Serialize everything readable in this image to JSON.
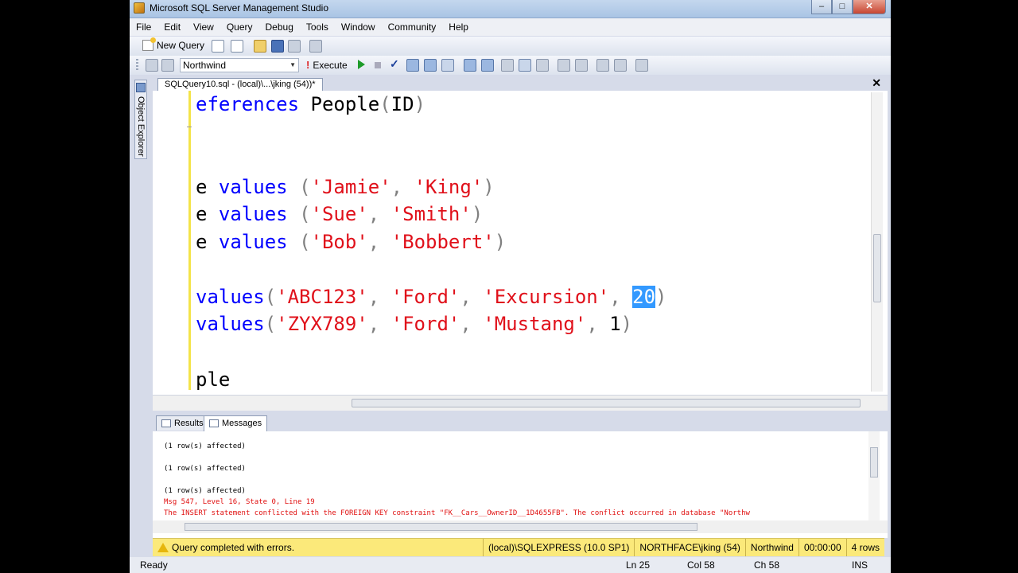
{
  "window": {
    "title": "Microsoft SQL Server Management Studio",
    "min": "–",
    "max": "□",
    "close": "✕"
  },
  "menu": [
    "File",
    "Edit",
    "View",
    "Query",
    "Debug",
    "Tools",
    "Window",
    "Community",
    "Help"
  ],
  "toolbar": {
    "new_query": "New Query",
    "database": "Northwind",
    "execute": "Execute",
    "execute_mark": "!"
  },
  "object_explorer": {
    "label": "Object Explorer"
  },
  "document": {
    "tab_title": "SQLQuery10.sql - (local)\\...\\jking (54))*",
    "close": "✕"
  },
  "code_lines": [
    {
      "segments": [
        {
          "t": "eferences ",
          "c": "kw"
        },
        {
          "t": "People",
          "c": "plain"
        },
        {
          "t": "(",
          "c": "op"
        },
        {
          "t": "ID",
          "c": "plain"
        },
        {
          "t": ")",
          "c": "op"
        }
      ]
    },
    {
      "segments": [
        {
          "t": "e ",
          "c": "plain"
        },
        {
          "t": "values ",
          "c": "kw"
        },
        {
          "t": "(",
          "c": "op"
        },
        {
          "t": "'Jamie'",
          "c": "str"
        },
        {
          "t": ", ",
          "c": "op"
        },
        {
          "t": "'King'",
          "c": "str"
        },
        {
          "t": ")",
          "c": "op"
        }
      ]
    },
    {
      "segments": [
        {
          "t": "e ",
          "c": "plain"
        },
        {
          "t": "values ",
          "c": "kw"
        },
        {
          "t": "(",
          "c": "op"
        },
        {
          "t": "'Sue'",
          "c": "str"
        },
        {
          "t": ", ",
          "c": "op"
        },
        {
          "t": "'Smith'",
          "c": "str"
        },
        {
          "t": ")",
          "c": "op"
        }
      ]
    },
    {
      "segments": [
        {
          "t": "e ",
          "c": "plain"
        },
        {
          "t": "values ",
          "c": "kw"
        },
        {
          "t": "(",
          "c": "op"
        },
        {
          "t": "'Bob'",
          "c": "str"
        },
        {
          "t": ", ",
          "c": "op"
        },
        {
          "t": "'Bobbert'",
          "c": "str"
        },
        {
          "t": ")",
          "c": "op"
        }
      ]
    },
    {
      "segments": [
        {
          "t": "values",
          "c": "kw"
        },
        {
          "t": "(",
          "c": "op"
        },
        {
          "t": "'ABC123'",
          "c": "str"
        },
        {
          "t": ", ",
          "c": "op"
        },
        {
          "t": "'Ford'",
          "c": "str"
        },
        {
          "t": ", ",
          "c": "op"
        },
        {
          "t": "'Excursion'",
          "c": "str"
        },
        {
          "t": ", ",
          "c": "op"
        },
        {
          "t": "20",
          "c": "hl"
        },
        {
          "t": ")",
          "c": "op"
        }
      ]
    },
    {
      "segments": [
        {
          "t": "values",
          "c": "kw"
        },
        {
          "t": "(",
          "c": "op"
        },
        {
          "t": "'ZYX789'",
          "c": "str"
        },
        {
          "t": ", ",
          "c": "op"
        },
        {
          "t": "'Ford'",
          "c": "str"
        },
        {
          "t": ", ",
          "c": "op"
        },
        {
          "t": "'Mustang'",
          "c": "str"
        },
        {
          "t": ", ",
          "c": "op"
        },
        {
          "t": "1",
          "c": "plain"
        },
        {
          "t": ")",
          "c": "op"
        }
      ]
    },
    {
      "segments": [
        {
          "t": "ple",
          "c": "plain"
        }
      ]
    }
  ],
  "results": {
    "tabs": [
      "Results",
      "Messages"
    ],
    "active_tab": "Messages",
    "messages": [
      {
        "text": "(1 row(s) affected)",
        "kind": "info"
      },
      {
        "text": "(1 row(s) affected)",
        "kind": "info"
      },
      {
        "text": "(1 row(s) affected)",
        "kind": "info"
      },
      {
        "text": "Msg 547, Level 16, State 0, Line 19",
        "kind": "err"
      },
      {
        "text": "The INSERT statement conflicted with the FOREIGN KEY constraint \"FK__Cars__OwnerID__1D4655FB\". The conflict occurred in database \"Northw",
        "kind": "err"
      }
    ]
  },
  "query_status": {
    "message": "Query completed with errors.",
    "server": "(local)\\SQLEXPRESS (10.0 SP1)",
    "user": "NORTHFACE\\jking (54)",
    "database": "Northwind",
    "elapsed": "00:00:00",
    "rows": "4 rows"
  },
  "statusbar": {
    "state": "Ready",
    "ln": "Ln 25",
    "col": "Col 58",
    "ch": "Ch 58",
    "mode": "INS"
  }
}
